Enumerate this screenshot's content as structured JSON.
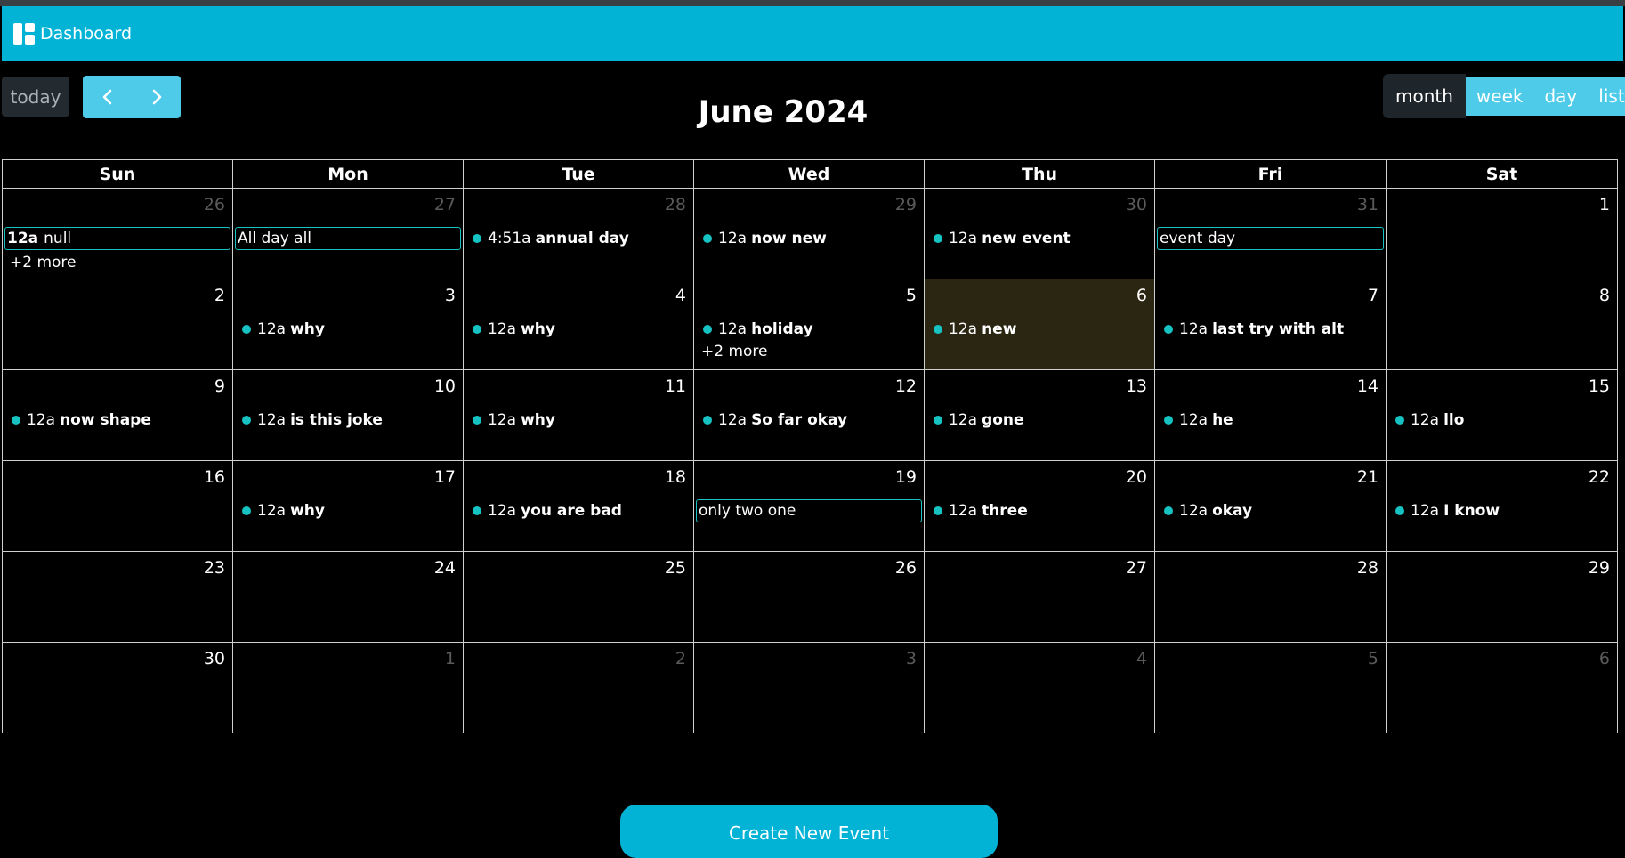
{
  "header": {
    "dashboard_label": "Dashboard"
  },
  "toolbar": {
    "today_label": "today",
    "title": "June 2024",
    "views": [
      "month",
      "week",
      "day",
      "list"
    ],
    "active_view": "month"
  },
  "weekdays": [
    "Sun",
    "Mon",
    "Tue",
    "Wed",
    "Thu",
    "Fri",
    "Sat"
  ],
  "today_cell": [
    1,
    4
  ],
  "weeks": [
    [
      {
        "day": "26",
        "other": true,
        "events": [
          {
            "kind": "block",
            "time": "12a",
            "title": "null"
          }
        ],
        "more": "+2 more"
      },
      {
        "day": "27",
        "other": true,
        "events": [
          {
            "kind": "block",
            "title": "All day all"
          }
        ]
      },
      {
        "day": "28",
        "other": true,
        "events": [
          {
            "kind": "dot",
            "time": "4:51a",
            "title": "annual day"
          }
        ]
      },
      {
        "day": "29",
        "other": true,
        "events": [
          {
            "kind": "dot",
            "time": "12a",
            "title": "now new"
          }
        ]
      },
      {
        "day": "30",
        "other": true,
        "events": [
          {
            "kind": "dot",
            "time": "12a",
            "title": "new event"
          }
        ]
      },
      {
        "day": "31",
        "other": true,
        "events": [
          {
            "kind": "block",
            "title": "event day"
          }
        ]
      },
      {
        "day": "1",
        "events": []
      }
    ],
    [
      {
        "day": "2",
        "events": []
      },
      {
        "day": "3",
        "events": [
          {
            "kind": "dot",
            "time": "12a",
            "title": "why"
          }
        ]
      },
      {
        "day": "4",
        "events": [
          {
            "kind": "dot",
            "time": "12a",
            "title": "why"
          }
        ]
      },
      {
        "day": "5",
        "events": [
          {
            "kind": "dot",
            "time": "12a",
            "title": "holiday"
          }
        ],
        "more": "+2 more"
      },
      {
        "day": "6",
        "events": [
          {
            "kind": "dot",
            "time": "12a",
            "title": "new"
          }
        ]
      },
      {
        "day": "7",
        "events": [
          {
            "kind": "dot",
            "time": "12a",
            "title": "last try with alt"
          }
        ]
      },
      {
        "day": "8",
        "events": []
      }
    ],
    [
      {
        "day": "9",
        "events": [
          {
            "kind": "dot",
            "time": "12a",
            "title": "now shape"
          }
        ]
      },
      {
        "day": "10",
        "events": [
          {
            "kind": "dot",
            "time": "12a",
            "title": "is this joke"
          }
        ]
      },
      {
        "day": "11",
        "events": [
          {
            "kind": "dot",
            "time": "12a",
            "title": "why"
          }
        ]
      },
      {
        "day": "12",
        "events": [
          {
            "kind": "dot",
            "time": "12a",
            "title": "So far okay"
          }
        ]
      },
      {
        "day": "13",
        "events": [
          {
            "kind": "dot",
            "time": "12a",
            "title": "gone"
          }
        ]
      },
      {
        "day": "14",
        "events": [
          {
            "kind": "dot",
            "time": "12a",
            "title": "he"
          }
        ]
      },
      {
        "day": "15",
        "events": [
          {
            "kind": "dot",
            "time": "12a",
            "title": "llo"
          }
        ]
      }
    ],
    [
      {
        "day": "16",
        "events": []
      },
      {
        "day": "17",
        "events": [
          {
            "kind": "dot",
            "time": "12a",
            "title": "why"
          }
        ]
      },
      {
        "day": "18",
        "events": [
          {
            "kind": "dot",
            "time": "12a",
            "title": "you are bad"
          }
        ]
      },
      {
        "day": "19",
        "events": [
          {
            "kind": "block",
            "title": "only two one"
          }
        ]
      },
      {
        "day": "20",
        "events": [
          {
            "kind": "dot",
            "time": "12a",
            "title": "three"
          }
        ]
      },
      {
        "day": "21",
        "events": [
          {
            "kind": "dot",
            "time": "12a",
            "title": "okay"
          }
        ]
      },
      {
        "day": "22",
        "events": [
          {
            "kind": "dot",
            "time": "12a",
            "title": "I know"
          }
        ]
      }
    ],
    [
      {
        "day": "23",
        "events": []
      },
      {
        "day": "24",
        "events": []
      },
      {
        "day": "25",
        "events": []
      },
      {
        "day": "26",
        "events": []
      },
      {
        "day": "27",
        "events": []
      },
      {
        "day": "28",
        "events": []
      },
      {
        "day": "29",
        "events": []
      }
    ],
    [
      {
        "day": "30",
        "events": []
      },
      {
        "day": "1",
        "other": true,
        "events": []
      },
      {
        "day": "2",
        "other": true,
        "events": []
      },
      {
        "day": "3",
        "other": true,
        "events": []
      },
      {
        "day": "4",
        "other": true,
        "events": []
      },
      {
        "day": "5",
        "other": true,
        "events": []
      },
      {
        "day": "6",
        "other": true,
        "events": []
      }
    ]
  ],
  "create_button_label": "Create New Event",
  "colors": {
    "accent": "#02b3d6",
    "event_dot": "#17c2c2",
    "today_bg": "#2b2611"
  }
}
